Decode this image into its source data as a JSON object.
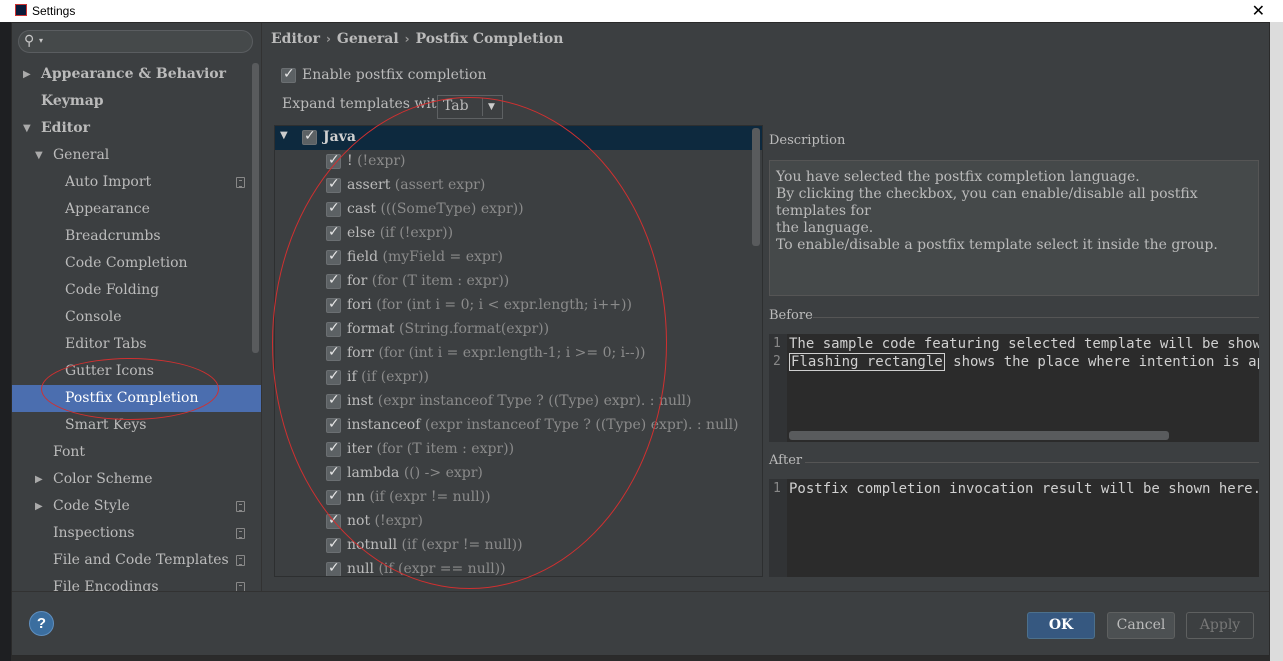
{
  "window": {
    "title": "Settings",
    "close_glyph": "✕"
  },
  "search": {
    "placeholder": ""
  },
  "sidebar": {
    "items": [
      {
        "label": "Appearance & Behavior",
        "level": 0,
        "arrow": "right",
        "bold": true
      },
      {
        "label": "Keymap",
        "level": 0,
        "arrow": "none",
        "bold": true
      },
      {
        "label": "Editor",
        "level": 0,
        "arrow": "down",
        "bold": true
      },
      {
        "label": "General",
        "level": 1,
        "arrow": "down"
      },
      {
        "label": "Auto Import",
        "level": 2,
        "copy": true
      },
      {
        "label": "Appearance",
        "level": 2
      },
      {
        "label": "Breadcrumbs",
        "level": 2
      },
      {
        "label": "Code Completion",
        "level": 2
      },
      {
        "label": "Code Folding",
        "level": 2
      },
      {
        "label": "Console",
        "level": 2
      },
      {
        "label": "Editor Tabs",
        "level": 2
      },
      {
        "label": "Gutter Icons",
        "level": 2
      },
      {
        "label": "Postfix Completion",
        "level": 2,
        "selected": true
      },
      {
        "label": "Smart Keys",
        "level": 2
      },
      {
        "label": "Font",
        "level": 1
      },
      {
        "label": "Color Scheme",
        "level": 1,
        "arrow": "right"
      },
      {
        "label": "Code Style",
        "level": 1,
        "arrow": "right",
        "copy": true
      },
      {
        "label": "Inspections",
        "level": 1,
        "copy": true
      },
      {
        "label": "File and Code Templates",
        "level": 1,
        "copy": true
      },
      {
        "label": "File Encodings",
        "level": 1,
        "copy": true
      }
    ]
  },
  "breadcrumb": {
    "parts": [
      "Editor",
      "General",
      "Postfix Completion"
    ],
    "separator": "›"
  },
  "options": {
    "enable_label": "Enable postfix completion",
    "enable_checked": true,
    "expand_label": "Expand templates with",
    "expand_value": "Tab"
  },
  "templates": {
    "group": "Java",
    "rows": [
      {
        "key": "!",
        "example": "(!expr)"
      },
      {
        "key": "assert",
        "example": "(assert expr)"
      },
      {
        "key": "cast",
        "example": "(((SomeType) expr))"
      },
      {
        "key": "else",
        "example": "(if (!expr))"
      },
      {
        "key": "field",
        "example": "(myField = expr)"
      },
      {
        "key": "for",
        "example": "(for (T item : expr))"
      },
      {
        "key": "fori",
        "example": "(for (int i = 0; i < expr.length; i++))"
      },
      {
        "key": "format",
        "example": "(String.format(expr))"
      },
      {
        "key": "forr",
        "example": "(for (int i = expr.length-1; i >= 0; i--))"
      },
      {
        "key": "if",
        "example": "(if (expr))"
      },
      {
        "key": "inst",
        "example": "(expr instanceof Type ? ((Type) expr). : null)"
      },
      {
        "key": "instanceof",
        "example": "(expr instanceof Type ? ((Type) expr). : null)"
      },
      {
        "key": "iter",
        "example": "(for (T item : expr))"
      },
      {
        "key": "lambda",
        "example": "(() -> expr)"
      },
      {
        "key": "nn",
        "example": "(if (expr != null))"
      },
      {
        "key": "not",
        "example": "(!expr)"
      },
      {
        "key": "notnull",
        "example": "(if (expr != null))"
      },
      {
        "key": "null",
        "example": "(if (expr == null))"
      }
    ]
  },
  "description": {
    "label": "Description",
    "lines": [
      "You have selected the postfix completion language.",
      "By clicking the checkbox, you can enable/disable all postfix templates for",
      "the language.",
      "To enable/disable a postfix template select it inside the group."
    ]
  },
  "before": {
    "label": "Before",
    "line1": "The sample code featuring selected template will be shown",
    "line2_highlight": "Flashing rectangle",
    "line2_rest": " shows the place where intention is ap",
    "ln1": "1",
    "ln2": "2"
  },
  "after": {
    "label": "After",
    "line1": "Postfix completion invocation result will be shown here.",
    "ln1": "1"
  },
  "buttons": {
    "help": "?",
    "ok": "OK",
    "cancel": "Cancel",
    "apply": "Apply"
  }
}
